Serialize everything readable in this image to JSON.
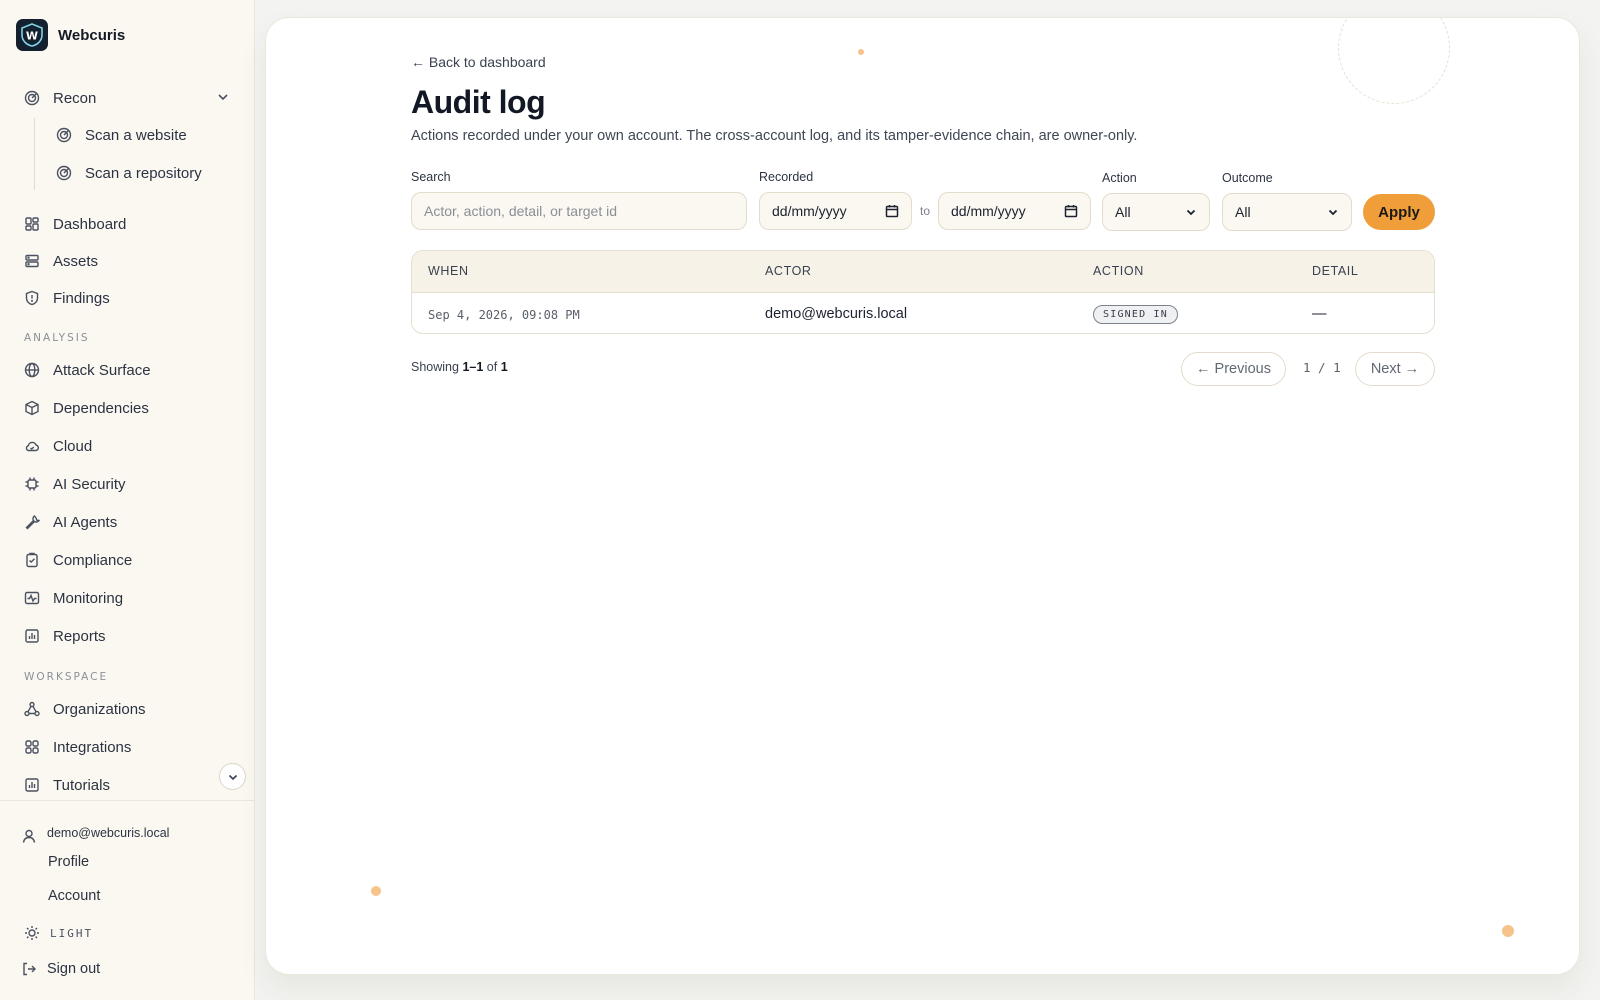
{
  "brand": {
    "name": "Webcuris",
    "logo_letter": "W"
  },
  "sidebar": {
    "recon": {
      "label": "Recon",
      "children": [
        "Scan a website",
        "Scan a repository"
      ]
    },
    "primary": [
      "Dashboard",
      "Assets",
      "Findings"
    ],
    "analysis_label": "ANALYSIS",
    "analysis": [
      "Attack Surface",
      "Dependencies",
      "Cloud",
      "AI Security",
      "AI Agents",
      "Compliance",
      "Monitoring",
      "Reports"
    ],
    "workspace_label": "WORKSPACE",
    "workspace": [
      "Organizations",
      "Integrations",
      "Tutorials"
    ]
  },
  "footer": {
    "user_email": "demo@webcuris.local",
    "profile": "Profile",
    "account": "Account",
    "theme": "LIGHT",
    "sign_out": "Sign out"
  },
  "page": {
    "back_link": "← Back to dashboard",
    "title": "Audit log",
    "subtitle": "Actions recorded under your own account. The cross-account log, and its tamper-evidence chain, are owner-only."
  },
  "filters": {
    "search_label": "Search",
    "search_placeholder": "Actor, action, detail, or target id",
    "recorded_label": "Recorded",
    "date_from": "dd/mm/yyyy",
    "to_label": "to",
    "date_to": "dd/mm/yyyy",
    "action_label": "Action",
    "action_value": "All",
    "outcome_label": "Outcome",
    "outcome_value": "All",
    "apply": "Apply"
  },
  "table": {
    "headers": [
      "WHEN",
      "ACTOR",
      "ACTION",
      "DETAIL"
    ],
    "rows": [
      {
        "when": "Sep 4, 2026, 09:08 PM",
        "actor": "demo@webcuris.local",
        "action": "SIGNED IN",
        "detail": "—"
      }
    ]
  },
  "pagination": {
    "showing_prefix": "Showing",
    "range": "1–1",
    "of": "of",
    "total": "1",
    "previous": "← Previous",
    "page_indicator": "1 / 1",
    "next": "Next →"
  }
}
